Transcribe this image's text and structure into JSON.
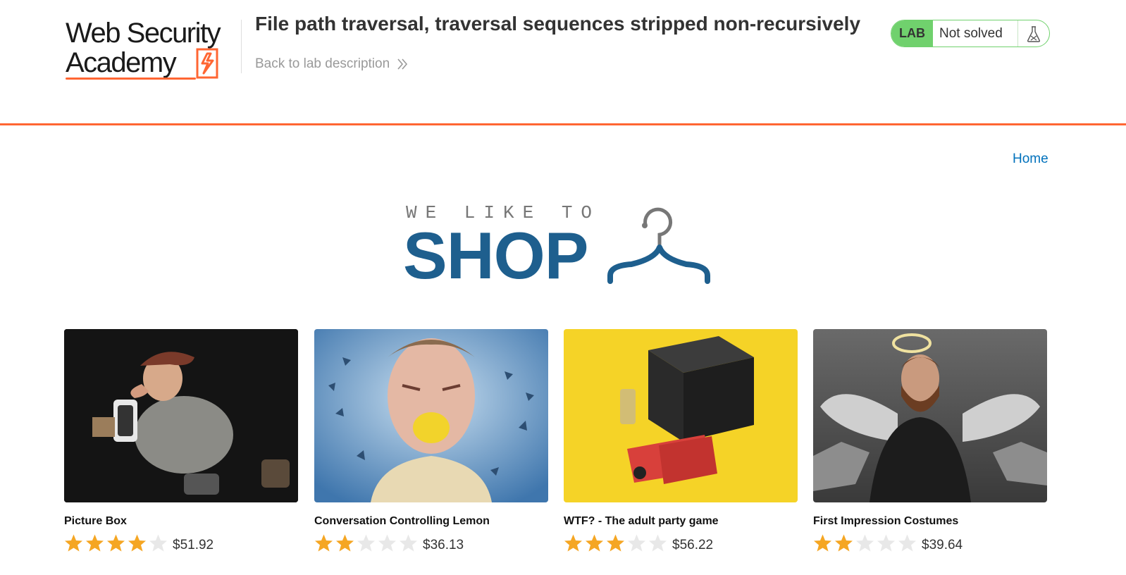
{
  "academy": {
    "logo_line1": "Web Security",
    "logo_line2": "Academy",
    "lab_title": "File path traversal, traversal sequences stripped non-recursively",
    "back_link": "Back to lab description",
    "lab_badge": "LAB",
    "lab_status": "Not solved",
    "colors": {
      "accent": "#ff6633",
      "lab_green": "#70d16d"
    }
  },
  "nav": {
    "home": "Home"
  },
  "banner": {
    "tagline": "WE LIKE TO",
    "word": "SHOP",
    "icon": "hanger-icon",
    "color": "#1e5f8e"
  },
  "products": [
    {
      "name": "Picture Box",
      "rating": 4,
      "max_rating": 5,
      "price": "$51.92",
      "image": "caricature photographer figurine"
    },
    {
      "name": "Conversation Controlling Lemon",
      "rating": 2,
      "max_rating": 5,
      "price": "$36.13",
      "image": "man with lemon in mouth"
    },
    {
      "name": "WTF? - The adult party game",
      "rating": 3,
      "max_rating": 5,
      "price": "$56.22",
      "image": "party game box on yellow background"
    },
    {
      "name": "First Impression Costumes",
      "rating": 2,
      "max_rating": 5,
      "price": "$39.64",
      "image": "bearded man with angel wings and halo"
    }
  ]
}
